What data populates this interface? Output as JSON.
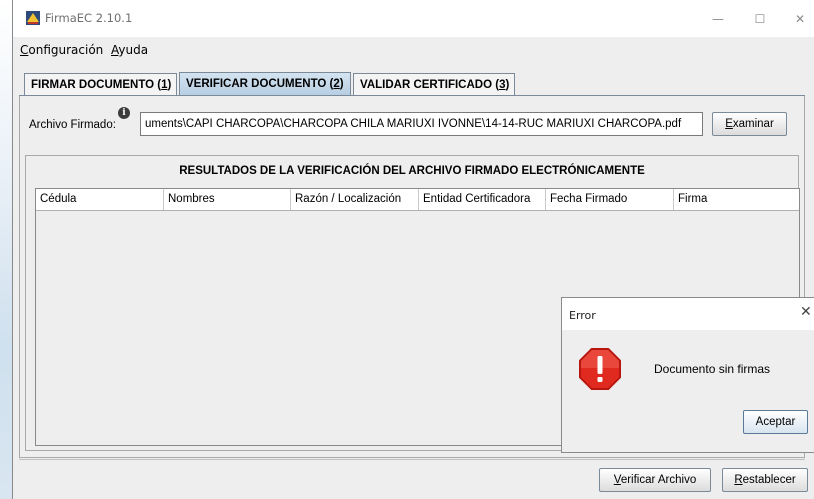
{
  "window": {
    "title": "FirmaEC 2.10.1",
    "minimize": "—",
    "maximize": "☐",
    "close": "✕"
  },
  "menu": [
    {
      "label": "Configuración",
      "key": "C"
    },
    {
      "label": "Ayuda",
      "key": "A"
    }
  ],
  "tabs": [
    {
      "label": "FIRMAR DOCUMENTO",
      "num": "1",
      "active": false
    },
    {
      "label": "VERIFICAR DOCUMENTO",
      "num": "2",
      "active": true
    },
    {
      "label": "VALIDAR CERTIFICADO",
      "num": "3",
      "active": false
    }
  ],
  "file": {
    "label": "Archivo Firmado:",
    "info_icon": "i",
    "value": "uments\\CAPI CHARCOPA\\CHARCOPA CHILA MARIUXI IVONNE\\14-14-RUC MARIUXI CHARCOPA.pdf",
    "browse_button": "Examinar"
  },
  "results": {
    "title": "RESULTADOS DE LA VERIFICACIÓN DEL ARCHIVO FIRMADO ELECTRÓNICAMENTE",
    "columns": [
      "Cédula",
      "Nombres",
      "Razón / Localización",
      "Entidad Certificadora",
      "Fecha Firmado",
      "Firma"
    ]
  },
  "actions": {
    "verify": "Verificar Archivo",
    "reset": "Restablecer"
  },
  "dialog": {
    "title": "Error",
    "close": "✕",
    "message": "Documento sin firmas",
    "ok_button": "Aceptar"
  },
  "colors": {
    "accent_tab": "#c3d6e8",
    "error_red": "#d9241b"
  }
}
